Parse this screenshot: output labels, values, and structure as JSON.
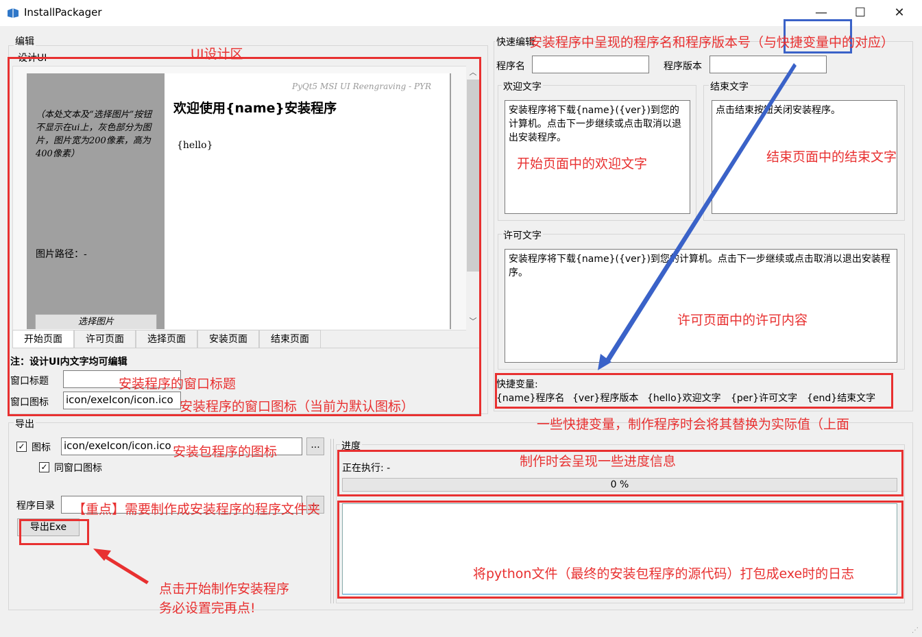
{
  "window": {
    "title": "InstallPackager",
    "controls": {
      "minimize": "—",
      "maximize": "☐",
      "close": "✕"
    }
  },
  "edit_group": {
    "label": "编辑",
    "design_ui_label": "设计UI",
    "preview": {
      "side_note": "（本处文本及“选择图片”按钮不显示在ui上，灰色部分为图片，图片宽为200像素，高为400像素）",
      "image_path": "图片路径：-",
      "choose_image": "选择图片",
      "watermark": "PyQt5 MSI UI Reengraving - PYR",
      "heading": "欢迎使用{name}安装程序",
      "body": "{hello}"
    },
    "tabs": [
      "开始页面",
      "许可页面",
      "选择页面",
      "安装页面",
      "结束页面"
    ],
    "note": "注：设计UI内文字均可编辑",
    "window_title_label": "窗口标题",
    "window_title_value": "",
    "window_icon_label": "窗口图标",
    "window_icon_value": "icon/exeIcon/icon.ico"
  },
  "quick_edit": {
    "label": "快速编辑",
    "name_label": "程序名",
    "name_value": "",
    "version_label": "程序版本",
    "version_value": "",
    "welcome_label": "欢迎文字",
    "welcome_text": "安装程序将下载{name}({ver})到您的计算机。点击下一步继续或点击取消以退出安装程序。",
    "end_label": "结束文字",
    "end_text": "点击结束按钮关闭安装程序。",
    "license_label": "许可文字",
    "license_text": "安装程序将下载{name}({ver})到您的计算机。点击下一步继续或点击取消以退出安装程序。",
    "shortcut_title": "快捷变量:",
    "shortcuts": [
      "{name}程序名",
      "{ver}程序版本",
      "{hello}欢迎文字",
      "{per}许可文字",
      "{end}结束文字"
    ]
  },
  "export_group": {
    "label": "导出",
    "icon_check_label": "图标",
    "icon_value": "icon/exeIcon/icon.ico",
    "same_icon_label": "同窗口图标",
    "browse": "...",
    "dir_label": "程序目录",
    "dir_value": "",
    "export_button": "导出Exe"
  },
  "progress_group": {
    "label": "进度",
    "running": "正在执行: -",
    "percent_text": "0 %",
    "percent": 0
  },
  "annotations": {
    "ui_area": "UI设计区",
    "name_ver": "安装程序中呈现的程序名和程序版本号（与快捷变量中的对应）",
    "welcome": "开始页面中的欢迎文字",
    "end": "结束页面中的结束文字",
    "license": "许可页面中的许可内容",
    "shortcuts": "一些快捷变量，制作程序时会将其替换为实际值（上面",
    "win_title": "安装程序的窗口标题",
    "win_icon": "安装程序的窗口图标（当前为默认图标）",
    "pkg_icon": "安装包程序的图标",
    "progress_info": "制作时会呈现一些进度信息",
    "dir": "【重点】需要制作成安装程序的程序文件夹",
    "log": "将python文件（最终的安装包程序的源代码）打包成exe时的日志",
    "click_line1": "点击开始制作安装程序",
    "click_line2": "务必设置完再点!"
  }
}
